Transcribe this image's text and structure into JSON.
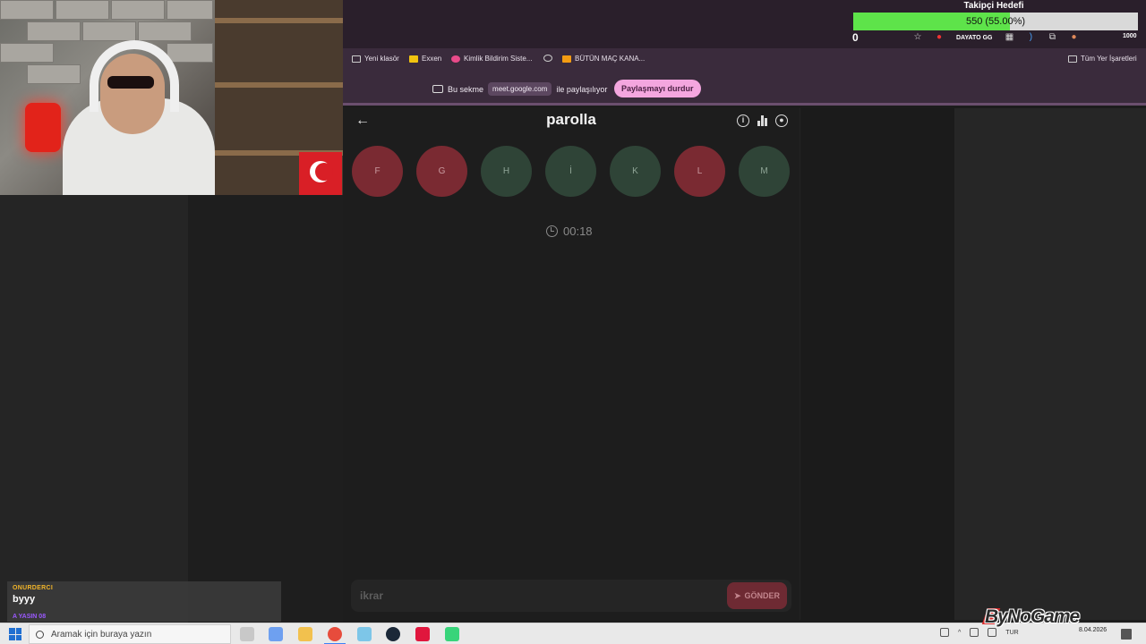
{
  "follower_goal": {
    "title": "Takipçi Hedefi",
    "label": "550 (55.00%)",
    "progress_fraction": 0.55,
    "counter": "0"
  },
  "browser": {
    "extension_badge": "DAYATO GG",
    "viewer_count": "1000",
    "bookmarks": [
      {
        "label": "Yeni klasör",
        "icon": "folder-icon"
      },
      {
        "label": "Exxen",
        "icon": "exxen-icon"
      },
      {
        "label": "Kimlik Bildirim Siste...",
        "icon": "kimlik-icon"
      },
      {
        "label": "",
        "icon": "globe-icon"
      },
      {
        "label": "BÜTÜN MAÇ KANA...",
        "icon": "jp-icon"
      }
    ],
    "all_bookmarks": "Tüm Yer İşaretleri",
    "share_bar": {
      "prefix": "Bu sekme",
      "host": "meet.google.com",
      "suffix": "ile paylaşılıyor",
      "stop_button": "Paylaşmayı durdur"
    }
  },
  "game": {
    "title": "parolla",
    "letters": [
      {
        "char": "F",
        "status": "wrong"
      },
      {
        "char": "G",
        "status": "wrong"
      },
      {
        "char": "H",
        "status": "correct"
      },
      {
        "char": "İ",
        "status": "correct"
      },
      {
        "char": "K",
        "status": "correct"
      },
      {
        "char": "L",
        "status": "wrong"
      },
      {
        "char": "M",
        "status": "correct"
      }
    ],
    "timer": "00:18",
    "answer_value": "ikrar",
    "send_label": "GÖNDER",
    "colors": {
      "wrong": "#7a2a32",
      "correct": "#2f4437"
    }
  },
  "chat": {
    "messages": [
      {
        "user": "ONURDERCI",
        "text": "byyy"
      },
      {
        "user": "A YASIN 08",
        "text": ""
      }
    ]
  },
  "taskbar": {
    "search_placeholder": "Aramak için buraya yazın",
    "language": "TUR",
    "date": "8.04.2026"
  },
  "watermark": "ByNoGame"
}
